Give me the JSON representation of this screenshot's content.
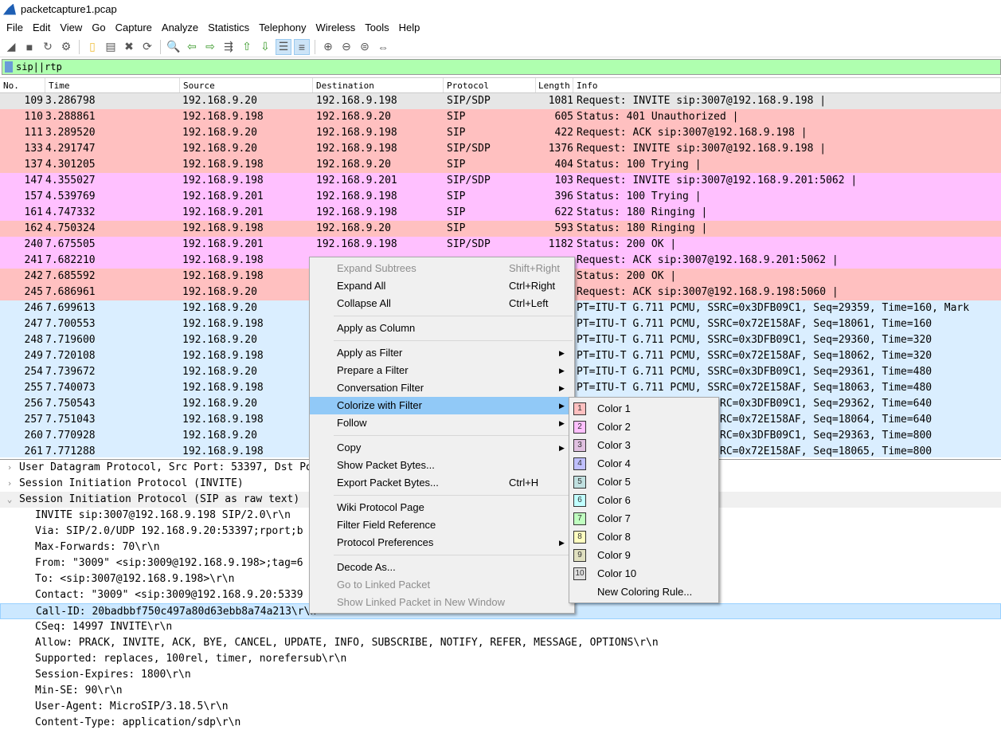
{
  "window": {
    "title": "packetcapture1.pcap"
  },
  "menu": [
    "File",
    "Edit",
    "View",
    "Go",
    "Capture",
    "Analyze",
    "Statistics",
    "Telephony",
    "Wireless",
    "Tools",
    "Help"
  ],
  "toolbar": [
    "shark-fin-start",
    "stop",
    "restart",
    "options",
    "open",
    "save",
    "close",
    "reload",
    "find",
    "back",
    "forward",
    "go-to",
    "first",
    "last",
    "autoscroll",
    "colorize",
    "zoom-in",
    "zoom-out",
    "zoom-normal",
    "resize-columns"
  ],
  "filter": {
    "value": "sip||rtp",
    "color": "#afffaf"
  },
  "columns": [
    "No.",
    "Time",
    "Source",
    "Destination",
    "Protocol",
    "Length",
    "Info"
  ],
  "colors": {
    "sip": "#ffc0c0",
    "sdp": "#ffc0ff",
    "rtp": "#daeeff",
    "selected": "#e6e6e6",
    "menu_highlight": "#91c9f7"
  },
  "packets": [
    {
      "no": "109",
      "time": "3.286798",
      "src": "192.168.9.20",
      "dst": "192.168.9.198",
      "proto": "SIP/SDP",
      "len": "1081",
      "info": "Request: INVITE sip:3007@192.168.9.198 |",
      "cls": "selected"
    },
    {
      "no": "110",
      "time": "3.288861",
      "src": "192.168.9.198",
      "dst": "192.168.9.20",
      "proto": "SIP",
      "len": "605",
      "info": "Status: 401 Unauthorized |",
      "cls": "sip"
    },
    {
      "no": "111",
      "time": "3.289520",
      "src": "192.168.9.20",
      "dst": "192.168.9.198",
      "proto": "SIP",
      "len": "422",
      "info": "Request: ACK sip:3007@192.168.9.198 |",
      "cls": "sip"
    },
    {
      "no": "133",
      "time": "4.291747",
      "src": "192.168.9.20",
      "dst": "192.168.9.198",
      "proto": "SIP/SDP",
      "len": "1376",
      "info": "Request: INVITE sip:3007@192.168.9.198 |",
      "cls": "sip"
    },
    {
      "no": "137",
      "time": "4.301205",
      "src": "192.168.9.198",
      "dst": "192.168.9.20",
      "proto": "SIP",
      "len": "404",
      "info": "Status: 100 Trying |",
      "cls": "sip"
    },
    {
      "no": "147",
      "time": "4.355027",
      "src": "192.168.9.198",
      "dst": "192.168.9.201",
      "proto": "SIP/SDP",
      "len": "103",
      "info": "Request: INVITE sip:3007@192.168.9.201:5062 |",
      "cls": "sdp"
    },
    {
      "no": "157",
      "time": "4.539769",
      "src": "192.168.9.201",
      "dst": "192.168.9.198",
      "proto": "SIP",
      "len": "396",
      "info": "Status: 100 Trying |",
      "cls": "sdp"
    },
    {
      "no": "161",
      "time": "4.747332",
      "src": "192.168.9.201",
      "dst": "192.168.9.198",
      "proto": "SIP",
      "len": "622",
      "info": "Status: 180 Ringing |",
      "cls": "sdp"
    },
    {
      "no": "162",
      "time": "4.750324",
      "src": "192.168.9.198",
      "dst": "192.168.9.20",
      "proto": "SIP",
      "len": "593",
      "info": "Status: 180 Ringing |",
      "cls": "sip"
    },
    {
      "no": "240",
      "time": "7.675505",
      "src": "192.168.9.201",
      "dst": "192.168.9.198",
      "proto": "SIP/SDP",
      "len": "1182",
      "info": "Status: 200 OK |",
      "cls": "sdp"
    },
    {
      "no": "241",
      "time": "7.682210",
      "src": "192.168.9.198",
      "dst": "",
      "proto": "",
      "len": "",
      "info": "Request: ACK sip:3007@192.168.9.201:5062 |",
      "cls": "sdp"
    },
    {
      "no": "242",
      "time": "7.685592",
      "src": "192.168.9.198",
      "dst": "",
      "proto": "",
      "len": "",
      "info": "Status: 200 OK |",
      "cls": "sip"
    },
    {
      "no": "245",
      "time": "7.686961",
      "src": "192.168.9.20",
      "dst": "",
      "proto": "",
      "len": "",
      "info": "Request: ACK sip:3007@192.168.9.198:5060 |",
      "cls": "sip"
    },
    {
      "no": "246",
      "time": "7.699613",
      "src": "192.168.9.20",
      "dst": "",
      "proto": "",
      "len": "",
      "info": "PT=ITU-T G.711 PCMU, SSRC=0x3DFB09C1, Seq=29359, Time=160, Mark",
      "cls": "rtp"
    },
    {
      "no": "247",
      "time": "7.700553",
      "src": "192.168.9.198",
      "dst": "",
      "proto": "",
      "len": "",
      "info": "PT=ITU-T G.711 PCMU, SSRC=0x72E158AF, Seq=18061, Time=160",
      "cls": "rtp"
    },
    {
      "no": "248",
      "time": "7.719600",
      "src": "192.168.9.20",
      "dst": "",
      "proto": "",
      "len": "",
      "info": "PT=ITU-T G.711 PCMU, SSRC=0x3DFB09C1, Seq=29360, Time=320",
      "cls": "rtp"
    },
    {
      "no": "249",
      "time": "7.720108",
      "src": "192.168.9.198",
      "dst": "",
      "proto": "",
      "len": "",
      "info": "PT=ITU-T G.711 PCMU, SSRC=0x72E158AF, Seq=18062, Time=320",
      "cls": "rtp"
    },
    {
      "no": "254",
      "time": "7.739672",
      "src": "192.168.9.20",
      "dst": "",
      "proto": "",
      "len": "",
      "info": "PT=ITU-T G.711 PCMU, SSRC=0x3DFB09C1, Seq=29361, Time=480",
      "cls": "rtp"
    },
    {
      "no": "255",
      "time": "7.740073",
      "src": "192.168.9.198",
      "dst": "",
      "proto": "",
      "len": "",
      "info": "PT=ITU-T G.711 PCMU, SSRC=0x72E158AF, Seq=18063, Time=480",
      "cls": "rtp"
    },
    {
      "no": "256",
      "time": "7.750543",
      "src": "192.168.9.20",
      "dst": "",
      "proto": "",
      "len": "",
      "info": "PT=ITU-T G.711 PCMU, SSRC=0x3DFB09C1, Seq=29362, Time=640",
      "cls": "rtp"
    },
    {
      "no": "257",
      "time": "7.751043",
      "src": "192.168.9.198",
      "dst": "",
      "proto": "",
      "len": "",
      "info": "PT=ITU-T G.711 PCMU, SSRC=0x72E158AF, Seq=18064, Time=640",
      "cls": "rtp"
    },
    {
      "no": "260",
      "time": "7.770928",
      "src": "192.168.9.20",
      "dst": "",
      "proto": "",
      "len": "",
      "info": "PT=ITU-T G.711 PCMU, SSRC=0x3DFB09C1, Seq=29363, Time=800",
      "cls": "rtp"
    },
    {
      "no": "261",
      "time": "7.771288",
      "src": "192.168.9.198",
      "dst": "",
      "proto": "",
      "len": "",
      "info": "PT=ITU-T G.711 PCMU, SSRC=0x72E158AF, Seq=18065, Time=800",
      "cls": "rtp"
    }
  ],
  "details": {
    "trees": [
      {
        "label": "User Datagram Protocol, Src Port: 53397, Dst Port: 5060",
        "expanded": false
      },
      {
        "label": "Session Initiation Protocol (INVITE)",
        "expanded": false
      },
      {
        "label": "Session Initiation Protocol (SIP as raw text)",
        "expanded": true
      }
    ],
    "lines": [
      "INVITE sip:3007@192.168.9.198 SIP/2.0\\r\\n",
      "Via: SIP/2.0/UDP 192.168.9.20:53397;rport;b",
      "Max-Forwards: 70\\r\\n",
      "From: \"3009\" <sip:3009@192.168.9.198>;tag=6",
      "To: <sip:3007@192.168.9.198>\\r\\n",
      "Contact: \"3009\" <sip:3009@192.168.9.20:5339",
      "Call-ID: 20badbbf750c497a80d63ebb8a74a213\\r\\n",
      "CSeq: 14997 INVITE\\r\\n",
      "Allow: PRACK, INVITE, ACK, BYE, CANCEL, UPDATE, INFO, SUBSCRIBE, NOTIFY, REFER, MESSAGE, OPTIONS\\r\\n",
      "Supported: replaces, 100rel, timer, norefersub\\r\\n",
      "Session-Expires: 1800\\r\\n",
      "Min-SE: 90\\r\\n",
      "User-Agent: MicroSIP/3.18.5\\r\\n",
      "Content-Type: application/sdp\\r\\n"
    ],
    "selected_line": 6
  },
  "context_menu": {
    "groups": [
      [
        {
          "label": "Expand Subtrees",
          "shortcut": "Shift+Right",
          "disabled": true
        },
        {
          "label": "Expand All",
          "shortcut": "Ctrl+Right"
        },
        {
          "label": "Collapse All",
          "shortcut": "Ctrl+Left"
        }
      ],
      [
        {
          "label": "Apply as Column"
        }
      ],
      [
        {
          "label": "Apply as Filter",
          "submenu": true
        },
        {
          "label": "Prepare a Filter",
          "submenu": true
        },
        {
          "label": "Conversation Filter",
          "submenu": true
        },
        {
          "label": "Colorize with Filter",
          "submenu": true,
          "active": true
        },
        {
          "label": "Follow",
          "submenu": true
        }
      ],
      [
        {
          "label": "Copy",
          "submenu": true
        },
        {
          "label": "Show Packet Bytes..."
        },
        {
          "label": "Export Packet Bytes...",
          "shortcut": "Ctrl+H"
        }
      ],
      [
        {
          "label": "Wiki Protocol Page"
        },
        {
          "label": "Filter Field Reference"
        },
        {
          "label": "Protocol Preferences",
          "submenu": true
        }
      ],
      [
        {
          "label": "Decode As..."
        },
        {
          "label": "Go to Linked Packet",
          "disabled": true
        },
        {
          "label": "Show Linked Packet in New Window",
          "disabled": true
        }
      ]
    ]
  },
  "colorize_submenu": {
    "items": [
      {
        "num": "1",
        "label": "Color 1",
        "color": "#ffc0c0"
      },
      {
        "num": "2",
        "label": "Color 2",
        "color": "#ffc0ff"
      },
      {
        "num": "3",
        "label": "Color 3",
        "color": "#e0c0e0"
      },
      {
        "num": "4",
        "label": "Color 4",
        "color": "#c0c0ff"
      },
      {
        "num": "5",
        "label": "Color 5",
        "color": "#c0e0e0"
      },
      {
        "num": "6",
        "label": "Color 6",
        "color": "#c0ffff"
      },
      {
        "num": "7",
        "label": "Color 7",
        "color": "#c0ffc0"
      },
      {
        "num": "8",
        "label": "Color 8",
        "color": "#ffffc0"
      },
      {
        "num": "9",
        "label": "Color 9",
        "color": "#e0e0c0"
      },
      {
        "num": "10",
        "label": "Color 10",
        "color": "#e0e0e0"
      }
    ],
    "new_rule": "New Coloring Rule..."
  }
}
